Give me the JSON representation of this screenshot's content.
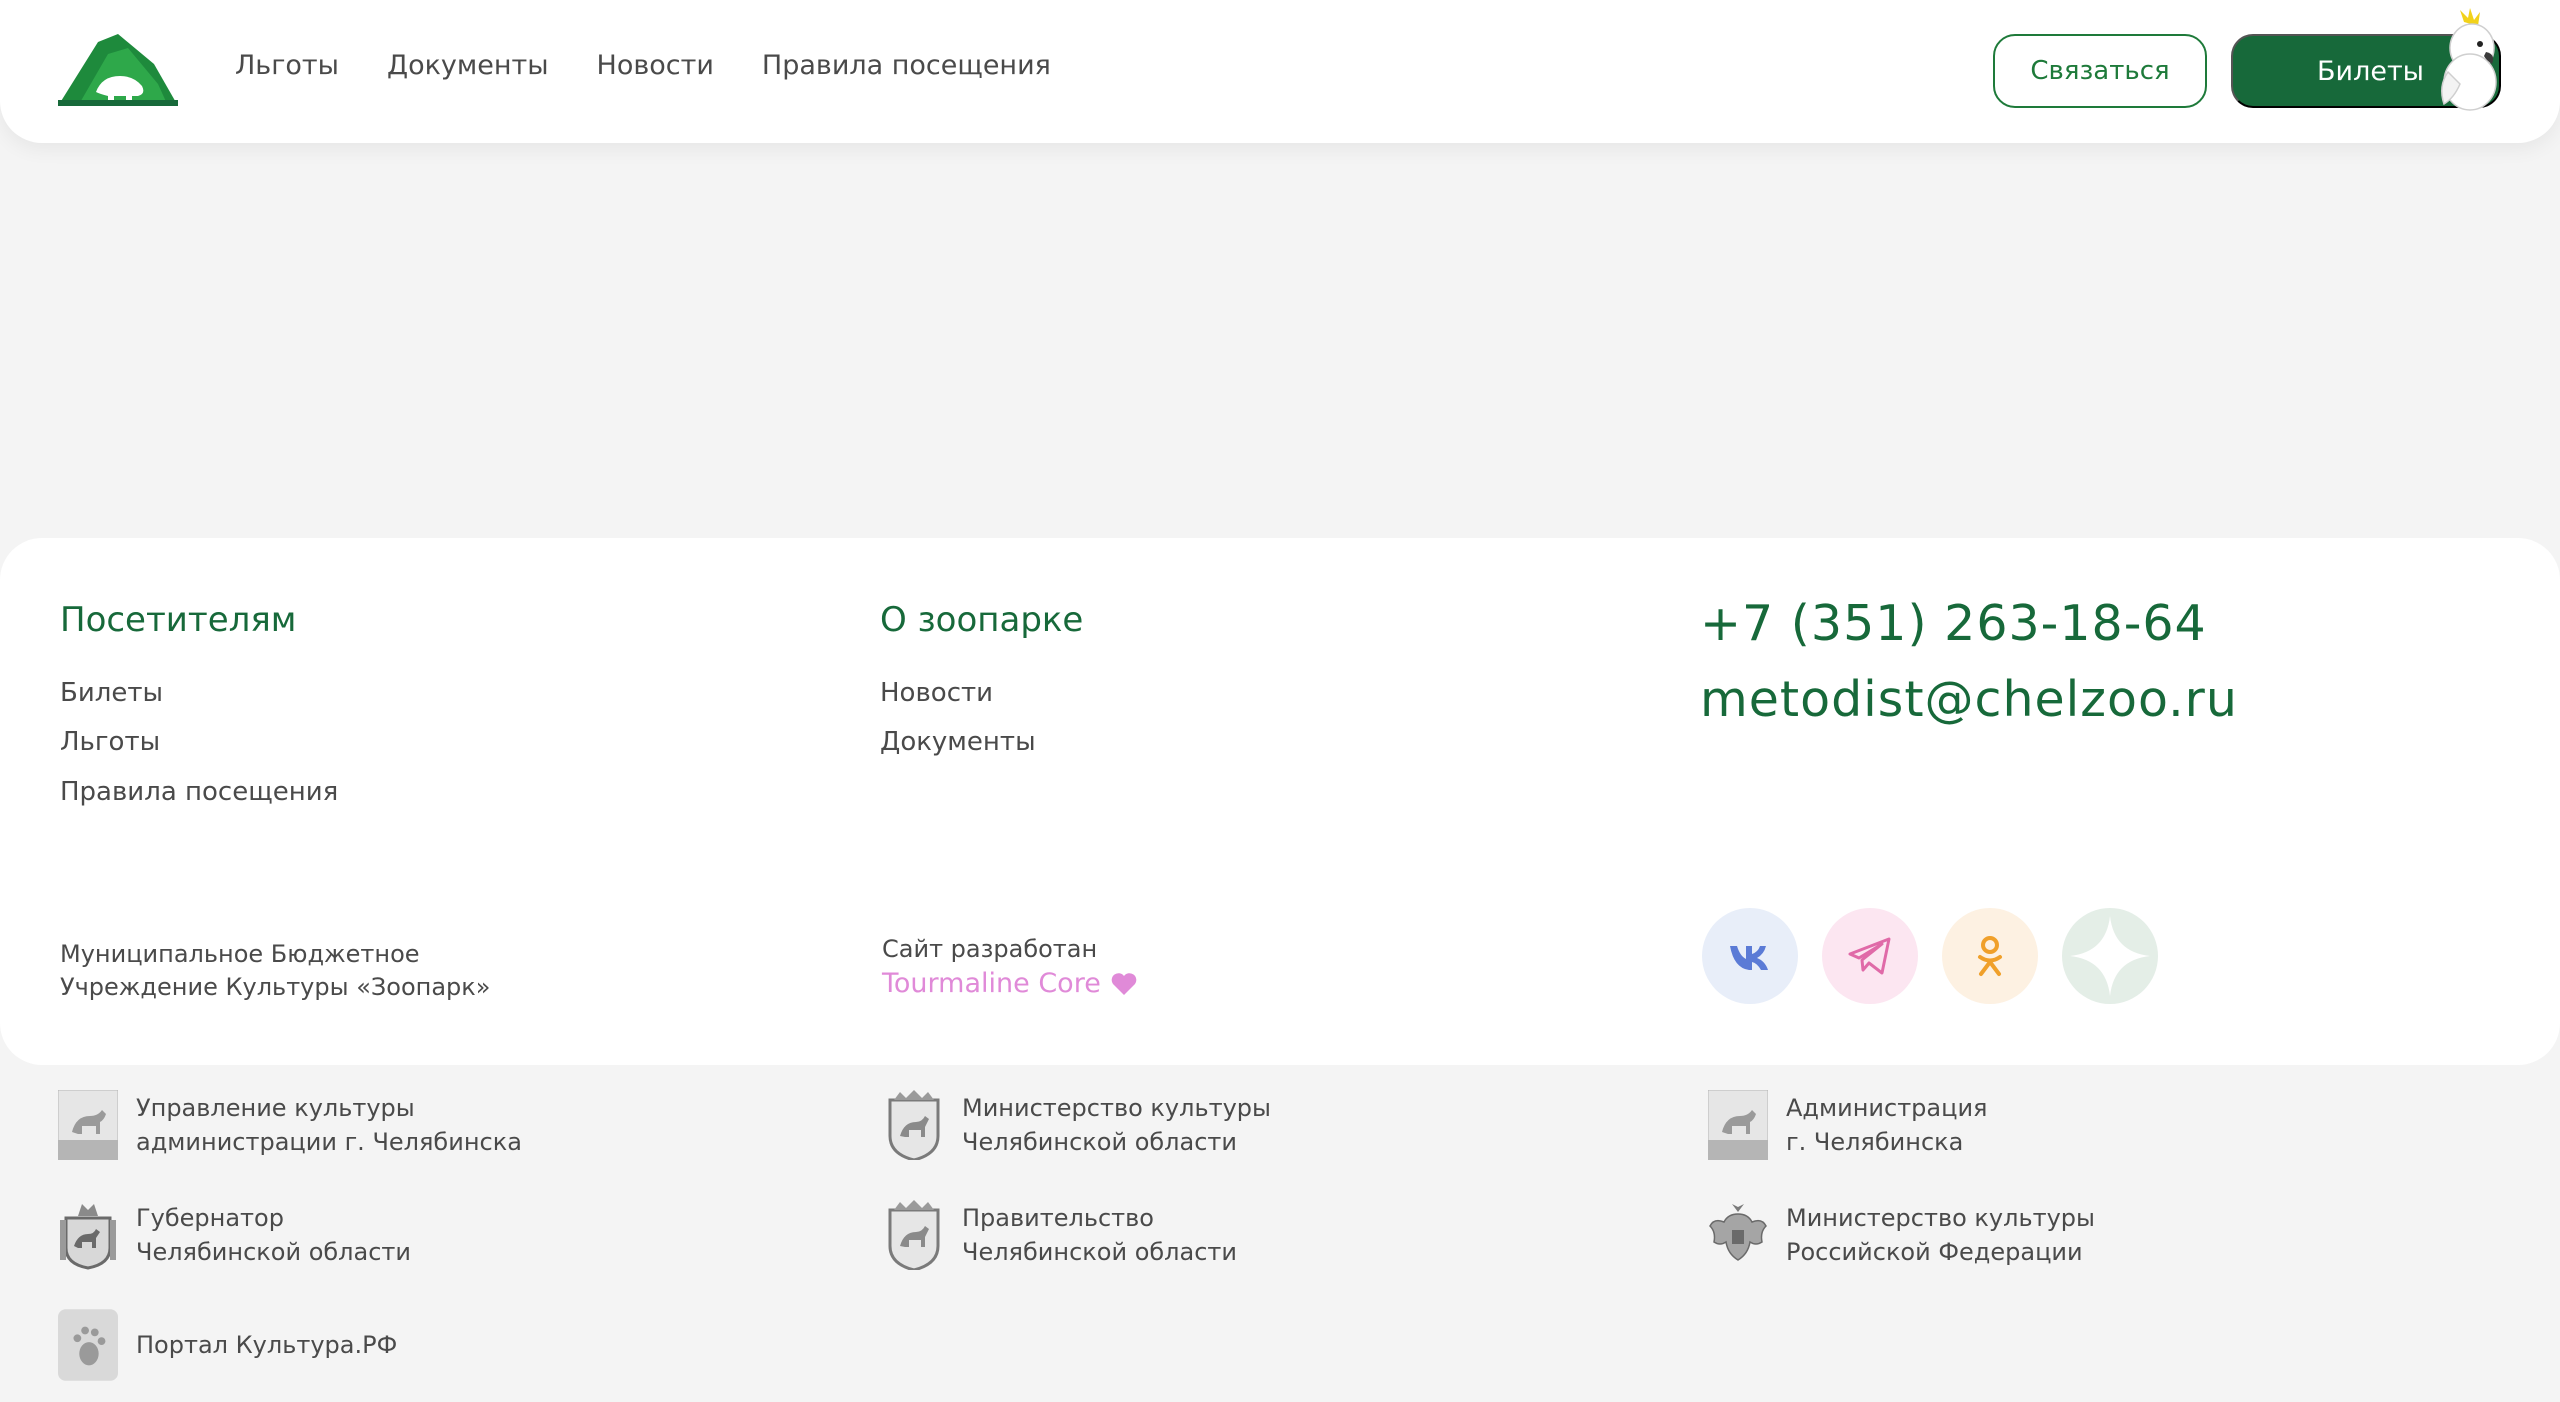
{
  "header": {
    "nav": [
      "Льготы",
      "Документы",
      "Новости",
      "Правила посещения"
    ],
    "contact_button": "Связаться",
    "tickets_button": "Билеты"
  },
  "footer": {
    "visitors": {
      "title": "Посетителям",
      "links": [
        "Билеты",
        "Льготы",
        "Правила посещения"
      ]
    },
    "about": {
      "title": "О зоопарке",
      "links": [
        "Новости",
        "Документы"
      ]
    },
    "contacts": {
      "phone": "+7 (351) 263-18-64",
      "email": "metodist@chelzoo.ru"
    },
    "org": [
      "Муниципальное Бюджетное",
      "Учреждение Культуры «Зоопарк»"
    ],
    "developer": {
      "label": "Сайт разработан",
      "name": "Tourmaline Core"
    },
    "social": [
      {
        "icon": "vk-icon",
        "bg": "#e8eef9",
        "color": "#5b7bd6"
      },
      {
        "icon": "telegram-icon",
        "bg": "#fce6f1",
        "color": "#e06aa8"
      },
      {
        "icon": "odnoklassniki-icon",
        "bg": "#fdf1e2",
        "color": "#f0a02a"
      },
      {
        "icon": "dzen-icon",
        "bg": "#e4eee7",
        "color": "#ffffff"
      }
    ]
  },
  "partners": [
    {
      "line1": "Управление культуры",
      "line2": "администрации г. Челябинска",
      "icon": "chelyabinsk-city-emblem-icon"
    },
    {
      "line1": "Министерство культуры",
      "line2": "Челябинской области",
      "icon": "chelyabinsk-region-emblem-icon"
    },
    {
      "line1": "Администрация",
      "line2": "г. Челябинска",
      "icon": "chelyabinsk-city-emblem-icon"
    },
    {
      "line1": "Губернатор",
      "line2": "Челябинской области",
      "icon": "governor-emblem-icon"
    },
    {
      "line1": "Правительство",
      "line2": "Челябинской области",
      "icon": "chelyabinsk-region-emblem-icon"
    },
    {
      "line1": "Министерство культуры",
      "line2": "Российской Федерации",
      "icon": "russia-eagle-icon"
    },
    {
      "line1": "Портал Культура.РФ",
      "line2": "",
      "icon": "culture-portal-icon"
    }
  ],
  "colors": {
    "brand": "#17693a",
    "accent_pink": "#e08ad8"
  }
}
